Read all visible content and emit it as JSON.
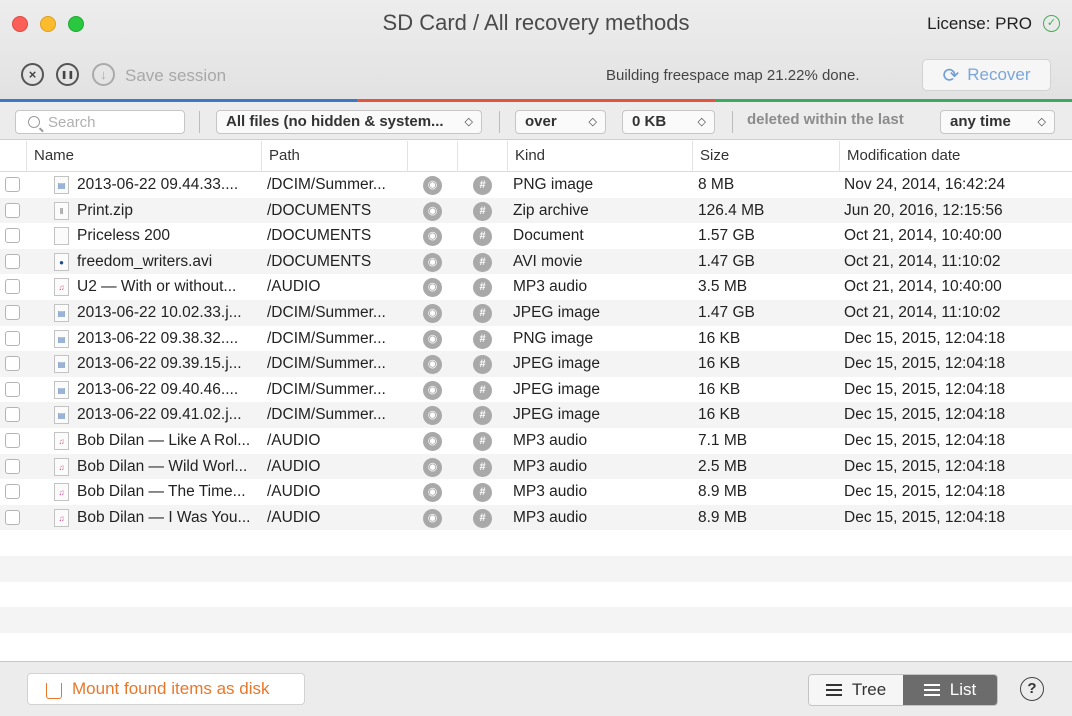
{
  "window": {
    "title": "SD Card / All recovery methods",
    "license": "License: PRO",
    "license_check_icon": "✓"
  },
  "toolbar": {
    "stop_icon": "×",
    "pause_icon": "❚❚",
    "save_icon": "↓",
    "save_label": "Save session",
    "status": "Building freespace map 21.22% done.",
    "recover_label": "Recover",
    "recover_icon": "⟳",
    "progress_colors": [
      "#3b78c9",
      "#e4543f",
      "#3aaa5d"
    ]
  },
  "filters": {
    "search_placeholder": "Search",
    "file_type": "All files (no hidden & system...",
    "comparator": "over",
    "size": "0 KB",
    "deleted_label": "deleted within the last",
    "time": "any time",
    "arrows": "◇"
  },
  "table": {
    "columns": {
      "name": "Name",
      "path": "Path",
      "kind": "Kind",
      "size": "Size",
      "date": "Modification date"
    },
    "rows": [
      {
        "name": "2013-06-22 09.44.33....",
        "path": "/DCIM/Summer...",
        "kind": "PNG image",
        "size": "8 MB",
        "date": "Nov 24, 2014, 16:42:24",
        "icon": "img"
      },
      {
        "name": "Print.zip",
        "path": "/DOCUMENTS",
        "kind": "Zip archive",
        "size": "126.4 MB",
        "date": "Jun 20, 2016, 12:15:56",
        "icon": "zip"
      },
      {
        "name": "Priceless 200",
        "path": "/DOCUMENTS",
        "kind": "Document",
        "size": "1.57 GB",
        "date": "Oct 21, 2014, 10:40:00",
        "icon": "doc"
      },
      {
        "name": "freedom_writers.avi",
        "path": "/DOCUMENTS",
        "kind": "AVI movie",
        "size": "1.47 GB",
        "date": "Oct 21, 2014, 11:10:02",
        "icon": "avi"
      },
      {
        "name": "U2 — With or without...",
        "path": "/AUDIO",
        "kind": "MP3 audio",
        "size": "3.5 MB",
        "date": "Oct 21, 2014, 10:40:00",
        "icon": "mp3"
      },
      {
        "name": "2013-06-22 10.02.33.j...",
        "path": "/DCIM/Summer...",
        "kind": "JPEG image",
        "size": "1.47 GB",
        "date": "Oct 21, 2014, 11:10:02",
        "icon": "img"
      },
      {
        "name": "2013-06-22 09.38.32....",
        "path": "/DCIM/Summer...",
        "kind": "PNG image",
        "size": "16 KB",
        "date": "Dec 15, 2015, 12:04:18",
        "icon": "img"
      },
      {
        "name": "2013-06-22 09.39.15.j...",
        "path": "/DCIM/Summer...",
        "kind": "JPEG image",
        "size": "16 KB",
        "date": "Dec 15, 2015, 12:04:18",
        "icon": "img"
      },
      {
        "name": "2013-06-22 09.40.46....",
        "path": "/DCIM/Summer...",
        "kind": "JPEG image",
        "size": "16 KB",
        "date": "Dec 15, 2015, 12:04:18",
        "icon": "img"
      },
      {
        "name": "2013-06-22 09.41.02.j...",
        "path": "/DCIM/Summer...",
        "kind": "JPEG image",
        "size": "16 KB",
        "date": "Dec 15, 2015, 12:04:18",
        "icon": "img"
      },
      {
        "name": "Bob Dilan — Like A Rol...",
        "path": "/AUDIO",
        "kind": "MP3 audio",
        "size": "7.1 MB",
        "date": "Dec 15, 2015, 12:04:18",
        "icon": "mp3"
      },
      {
        "name": "Bob Dilan — Wild Worl...",
        "path": "/AUDIO",
        "kind": "MP3 audio",
        "size": "2.5 MB",
        "date": "Dec 15, 2015, 12:04:18",
        "icon": "mp3"
      },
      {
        "name": "Bob Dilan — The Time...",
        "path": "/AUDIO",
        "kind": "MP3 audio",
        "size": "8.9 MB",
        "date": "Dec 15, 2015, 12:04:18",
        "icon": "mp3"
      },
      {
        "name": "Bob Dilan — I Was You...",
        "path": "/AUDIO",
        "kind": "MP3 audio",
        "size": "8.9 MB",
        "date": "Dec 15, 2015, 12:04:18",
        "icon": "mp3"
      }
    ],
    "preview_icon": "◉",
    "hash_icon": "#"
  },
  "bottom": {
    "mount_label": "Mount found items as disk",
    "tree_label": "Tree",
    "list_label": "List",
    "help_label": "?"
  }
}
